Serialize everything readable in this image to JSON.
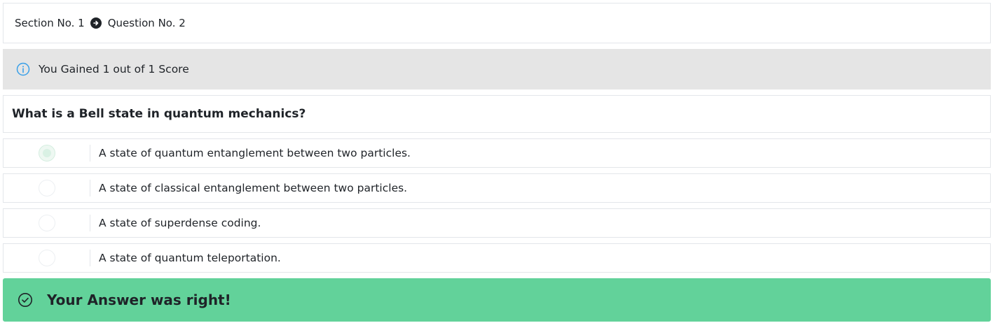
{
  "breadcrumb": {
    "section": "Section No. 1",
    "question": "Question No. 2"
  },
  "score": {
    "text": "You Gained 1 out of 1 Score",
    "icon": "info-icon"
  },
  "question": {
    "text": "What is a Bell state in quantum mechanics?"
  },
  "options": [
    {
      "label": "A state of quantum entanglement between two particles.",
      "selected": true
    },
    {
      "label": "A state of classical entanglement between two particles.",
      "selected": false
    },
    {
      "label": "A state of superdense coding.",
      "selected": false
    },
    {
      "label": "A state of quantum teleportation.",
      "selected": false
    }
  ],
  "result": {
    "text": "Your Answer was right!",
    "icon": "check-circle-icon"
  },
  "colors": {
    "success": "#62d29a",
    "info_banner": "#e5e5e5",
    "info_icon": "#3aa0e8"
  }
}
